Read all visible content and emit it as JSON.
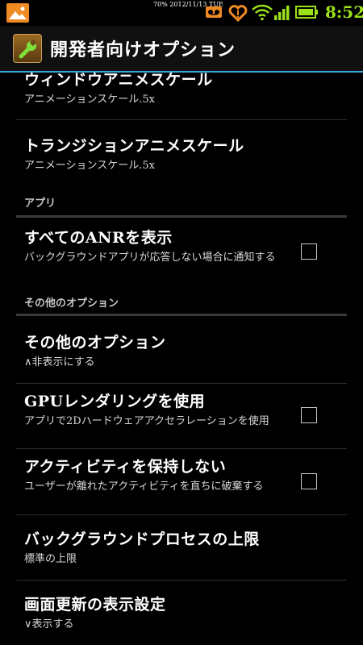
{
  "status_bar": {
    "date_text": "70% 2012/11/13 TUE",
    "time": "8:52",
    "icons": [
      "gallery-icon",
      "voicemail-icon",
      "heart-alert-icon",
      "wifi-icon",
      "signal-icon",
      "battery-icon"
    ],
    "accent_color": "#9be21a"
  },
  "action_bar": {
    "title": "開発者向けオプション",
    "accent_color": "#39a7d9"
  },
  "items": [
    {
      "title": "ウィンドウアニメスケール",
      "summary": "アニメーションスケール.5x"
    },
    {
      "title": "トランジションアニメスケール",
      "summary": "アニメーションスケール.5x"
    },
    {
      "title": "すべてのANRを表示",
      "summary": "バックグラウンドアプリが応答しない場合に通知する"
    },
    {
      "title": "その他のオプション",
      "summary": "∧非表示にする"
    },
    {
      "title": "GPUレンダリングを使用",
      "summary": "アプリで2Dハードウェアアクセラレーションを使用"
    },
    {
      "title": "アクティビティを保持しない",
      "summary": "ユーザーが離れたアクティビティを直ちに破棄する"
    },
    {
      "title": "バックグラウンドプロセスの上限",
      "summary": "標準の上限"
    },
    {
      "title": "画面更新の表示設定",
      "summary": "∨表示する"
    }
  ],
  "categories": {
    "apps": "アプリ",
    "other": "その他のオプション"
  }
}
